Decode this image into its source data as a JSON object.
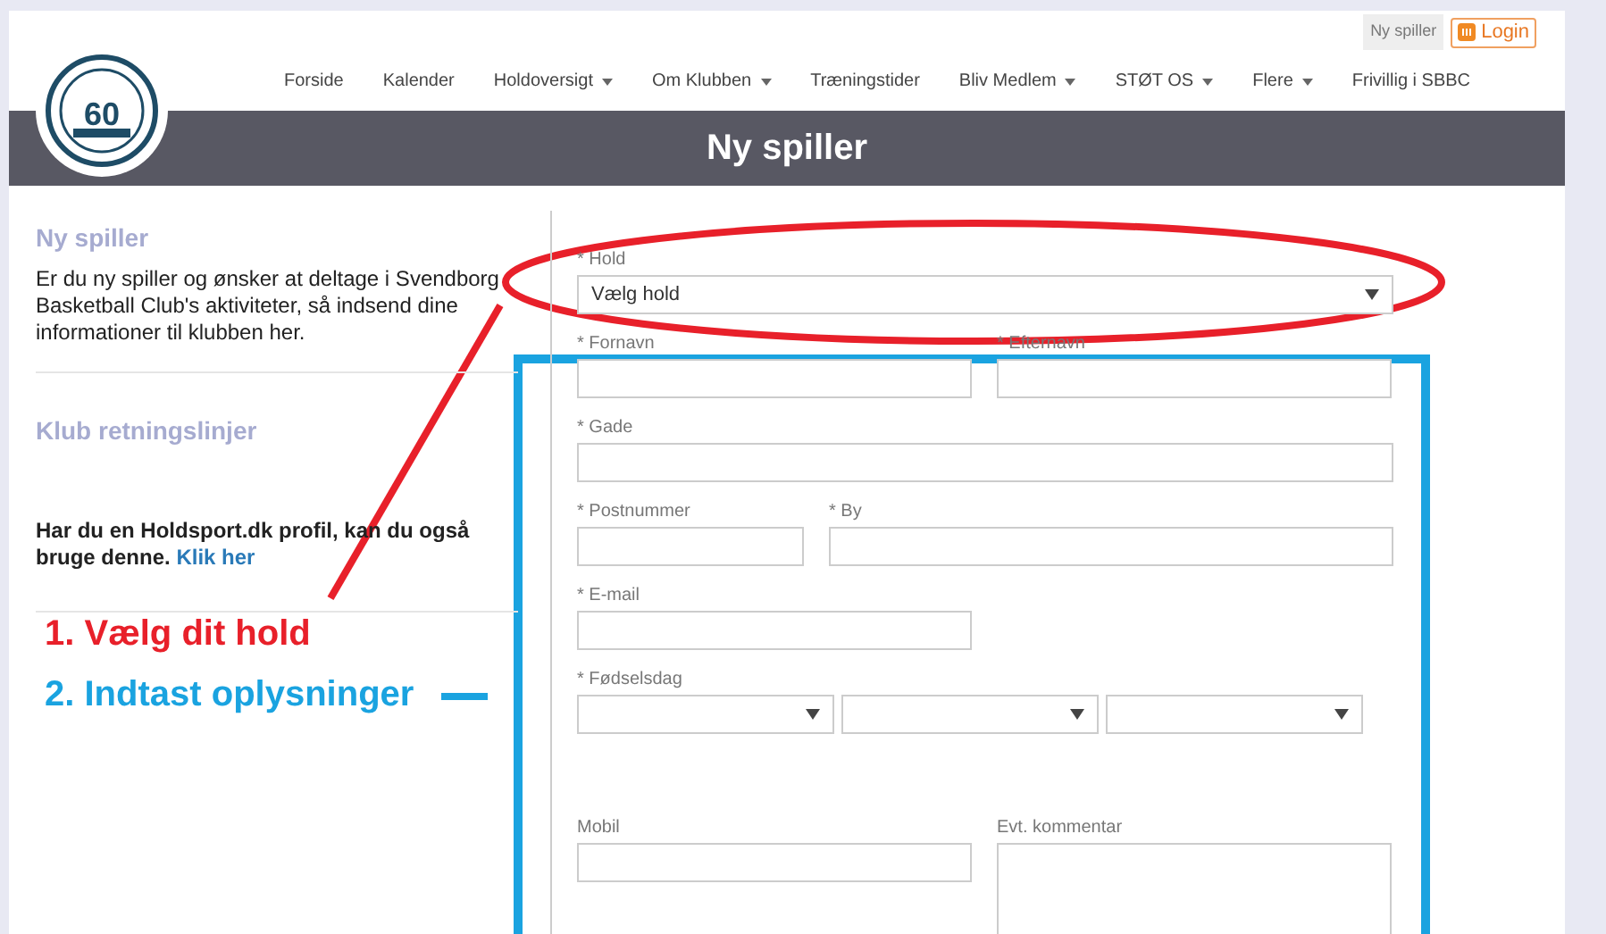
{
  "header": {
    "top_links": [
      {
        "label": "Ny spiller",
        "kind": "plain"
      },
      {
        "label": "Login",
        "kind": "login"
      }
    ],
    "logo_text": "60",
    "menu": [
      {
        "label": "Forside",
        "dropdown": false
      },
      {
        "label": "Kalender",
        "dropdown": false
      },
      {
        "label": "Holdoversigt",
        "dropdown": true
      },
      {
        "label": "Om Klubben",
        "dropdown": true
      },
      {
        "label": "Træningstider",
        "dropdown": false
      },
      {
        "label": "Bliv Medlem",
        "dropdown": true
      },
      {
        "label": "STØT OS",
        "dropdown": true
      },
      {
        "label": "Flere",
        "dropdown": true
      },
      {
        "label": "Frivillig i SBBC",
        "dropdown": false
      }
    ],
    "title": "Ny spiller"
  },
  "sidebar": [
    {
      "heading": "Ny spiller",
      "text": "Er du ny spiller og ønsker at deltage i Svendborg Basketball Club's aktiviteter, så indsend dine informationer til klubben her."
    },
    {
      "heading": "Klub retningslinjer",
      "text": "Har du en Holdsport.dk profil, kan du også bruge denne.",
      "link": "Klik her"
    }
  ],
  "form": {
    "rows": [
      [
        {
          "label": "* Hold",
          "kind": "select",
          "value": "Vælg hold"
        }
      ],
      [
        {
          "label": "* Fornavn",
          "kind": "text"
        },
        {
          "label": "* Efternavn",
          "kind": "text"
        }
      ],
      [
        {
          "label": "* Gade",
          "kind": "text"
        }
      ],
      [
        {
          "label": "* Postnummer",
          "kind": "text"
        },
        {
          "label": "* By",
          "kind": "text"
        }
      ],
      [
        {
          "label": "* E-mail",
          "kind": "text"
        }
      ],
      [
        {
          "label": "* Fødselsdag",
          "kind": "date"
        }
      ],
      [
        {
          "label": "Mobil",
          "kind": "text"
        },
        {
          "label": "Evt. kommentar",
          "kind": "textarea"
        }
      ]
    ]
  },
  "annotations": [
    {
      "text": "1. Vælg dit hold",
      "color": "#e8202a"
    },
    {
      "text": "2. Indtast oplysninger",
      "color": "#1aa3e0"
    }
  ]
}
